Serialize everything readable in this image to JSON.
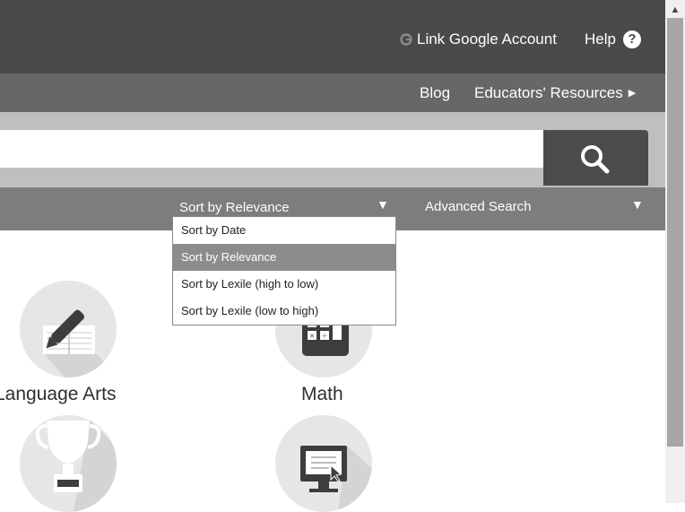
{
  "header": {
    "link_google": "Link Google Account",
    "help": "Help",
    "help_icon": "?"
  },
  "nav": {
    "blog": "Blog",
    "educators": "Educators' Resources"
  },
  "search": {
    "value": "",
    "placeholder": ""
  },
  "sortbar": {
    "sort_selected": "Sort by Relevance",
    "advanced": "Advanced Search"
  },
  "sort_options": [
    "Sort by Date",
    "Sort by Relevance",
    "Sort by Lexile (high to low)",
    "Sort by Lexile (low to high)"
  ],
  "subjects": [
    {
      "label": "Language Arts",
      "icon": "pencil-notebook-icon"
    },
    {
      "label": "Math",
      "icon": "calculator-icon"
    },
    {
      "label": "",
      "icon": "trophy-icon"
    },
    {
      "label": "",
      "icon": "computer-monitor-icon"
    }
  ],
  "colors": {
    "topbar": "#4a4a4a",
    "navbar": "#676767",
    "searchband": "#bfbfbf",
    "sortbar": "#7d7d7d",
    "selected_option": "#8c8c8c"
  }
}
